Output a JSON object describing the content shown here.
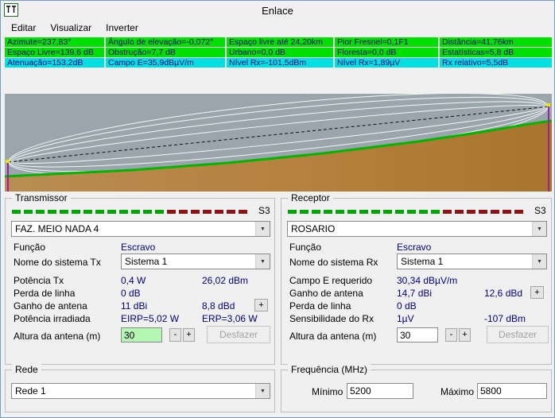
{
  "window": {
    "title": "Enlace"
  },
  "menu": {
    "items": [
      {
        "label": "Editar"
      },
      {
        "label": "Visualizar"
      },
      {
        "label": "Inverter"
      }
    ]
  },
  "icons": {
    "chevron_down": "▼"
  },
  "info": {
    "rows": [
      {
        "cells": [
          "Azimute=237,83°",
          "Ângulo de elevação=-0,072°",
          "Espaço livre até 24,20km",
          "Pior Fresnel=0,1F1",
          "Distância=41,76km"
        ]
      },
      {
        "cells": [
          "Espaço Livre=139,6 dB",
          "Obstrução=7,7 dB",
          "Urbano=0,0 dB",
          "Floresta=0,0 dB",
          "Estatísticas=5,8 dB"
        ]
      },
      {
        "cells": [
          "Atenuação=153,2dB",
          "Campo E=35,9dBµV/m",
          "Nível Rx=-101,5dBm",
          "Nível Rx=1,89µV",
          "Rx relativo=5,5dB"
        ]
      }
    ]
  },
  "colors": {
    "row_green": "#00df00",
    "row_cyan": "#00e0e0",
    "sky": "#9aa6ab",
    "terrain": "#b5813e",
    "vegetation": "#00b400",
    "value_text": "#000080"
  },
  "tx": {
    "title": "Transmissor",
    "meter": {
      "green": 13,
      "red": 7,
      "label": "S3"
    },
    "station": "FAZ. MEIO NADA 4",
    "funcao": {
      "label": "Função",
      "value": "Escravo"
    },
    "sistema": {
      "label": "Nome do sistema Tx",
      "value": "Sistema 1"
    },
    "potencia": {
      "label": "Potência Tx",
      "v1": "0,4 W",
      "v2": "26,02 dBm"
    },
    "perda": {
      "label": "Perda de linha",
      "v1": "0 dB"
    },
    "ganho": {
      "label": "Ganho de antena",
      "v1": "11 dBi",
      "v2": "8,8 dBd",
      "plus": "+"
    },
    "irradiada": {
      "label": "Potência irradiada",
      "v1": "EIRP=5,02 W",
      "v2": "ERP=3,06 W"
    },
    "altura": {
      "label": "Altura da antena (m)",
      "value": "30",
      "minus": "-",
      "plus": "+",
      "undo": "Desfazer"
    }
  },
  "rx": {
    "title": "Receptor",
    "meter": {
      "green": 13,
      "red": 7,
      "label": "S3"
    },
    "station": "ROSARIO",
    "funcao": {
      "label": "Função",
      "value": "Escravo"
    },
    "sistema": {
      "label": "Nome do sistema Rx",
      "value": "Sistema 1"
    },
    "campo": {
      "label": "Campo E requerido",
      "v1": "30,34 dBµV/m"
    },
    "ganho": {
      "label": "Ganho de antena",
      "v1": "14,7 dBi",
      "v2": "12,6 dBd",
      "plus": "+"
    },
    "perda": {
      "label": "Perda de linha",
      "v1": "0 dB"
    },
    "sens": {
      "label": "Sensibilidade do Rx",
      "v1": "1µV",
      "v2": "-107 dBm"
    },
    "altura": {
      "label": "Altura da antena (m)",
      "value": "30",
      "minus": "-",
      "plus": "+",
      "undo": "Desfazer"
    }
  },
  "rede": {
    "title": "Rede",
    "value": "Rede 1"
  },
  "freq": {
    "title": "Frequência (MHz)",
    "minimo_label": "Mínimo",
    "minimo": "5200",
    "maximo_label": "Máximo",
    "maximo": "5800"
  }
}
